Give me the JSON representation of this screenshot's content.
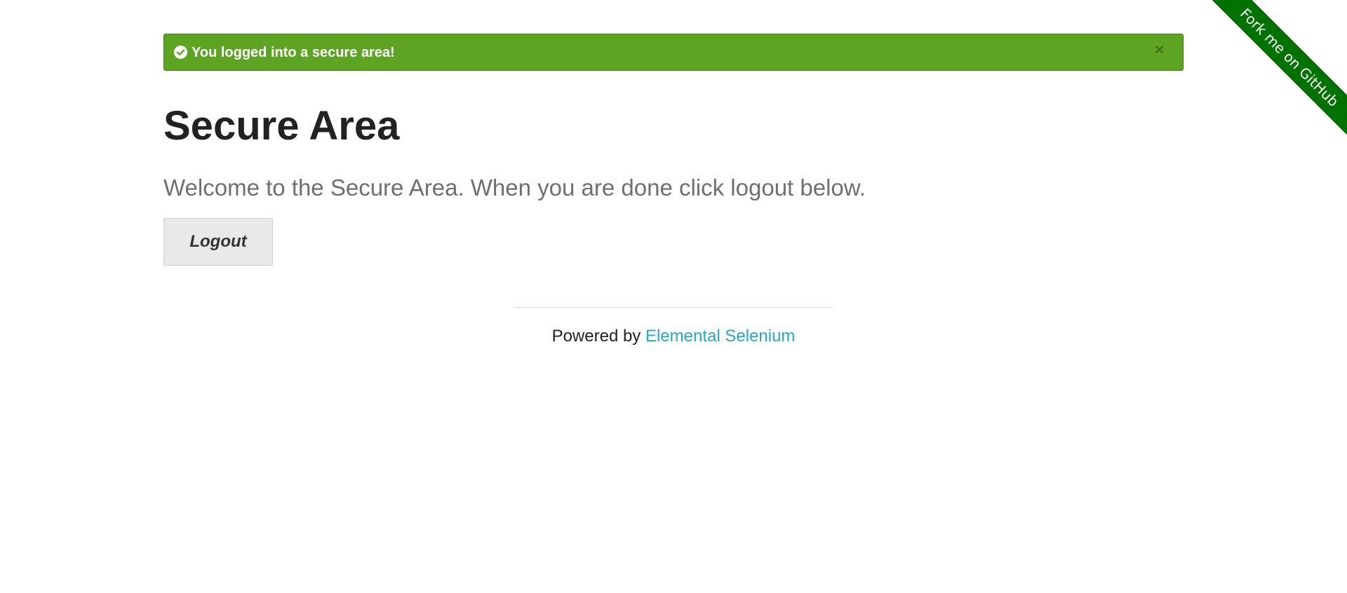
{
  "flash": {
    "message": "You logged into a secure area!",
    "close_symbol": "×",
    "icon": "check-circle-icon",
    "color": "#5da423"
  },
  "main": {
    "title": "Secure Area",
    "subheader": "Welcome to the Secure Area. When you are done click logout below.",
    "logout_label": "Logout"
  },
  "footer": {
    "prefix": "Powered by ",
    "link_text": "Elemental Selenium",
    "link_color": "#2ba6cb"
  },
  "ribbon": {
    "label": "Fork me on GitHub",
    "color": "#007200"
  }
}
